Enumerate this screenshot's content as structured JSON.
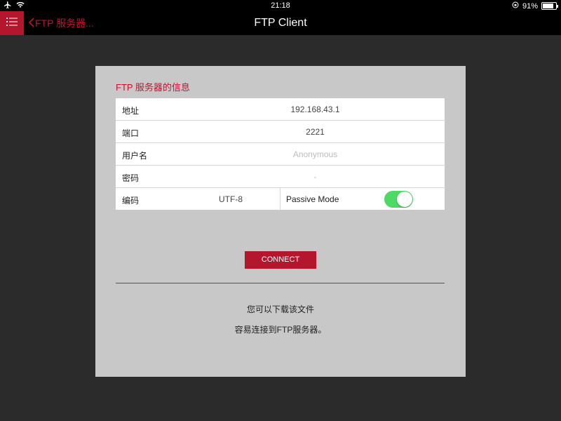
{
  "status_bar": {
    "time": "21:18",
    "battery_text": "91%",
    "battery_level": 0.91
  },
  "nav": {
    "back_label": "FTP 服务器...",
    "title": "FTP Client",
    "menu_icon": "list-icon",
    "back_icon": "chevron-left-icon"
  },
  "panel": {
    "section_title": "FTP 服务器的信息",
    "fields": {
      "address": {
        "label": "地址",
        "value": "192.168.43.1"
      },
      "port": {
        "label": "端口",
        "value": "2221"
      },
      "username": {
        "label": "用户名",
        "placeholder": "Anonymous"
      },
      "password": {
        "label": "密码",
        "placeholder": "-"
      },
      "encoding": {
        "label": "编码",
        "value": "UTF-8"
      },
      "passive_mode": {
        "label": "Passive Mode",
        "enabled": true
      }
    },
    "connect_label": "CONNECT",
    "info_line1": "您可以下载该文件",
    "info_line2": "容易连接到FTP服务器。"
  },
  "colors": {
    "accent": "#b3162d",
    "title_red": "#c8102e",
    "toggle_on": "#4cd964",
    "panel_bg": "#c8c8c8",
    "page_bg": "#2b2b2b"
  }
}
